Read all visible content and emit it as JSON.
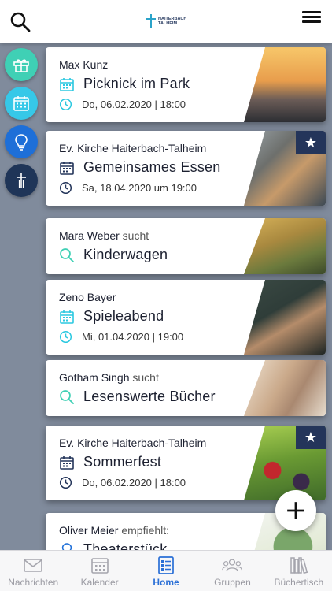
{
  "header": {
    "logo_line1": "HAITERBACH",
    "logo_line2": "TALHEIM"
  },
  "bubbles": [
    {
      "icon": "gift-icon",
      "color": "#3fd0b5"
    },
    {
      "icon": "calendar-icon",
      "color": "#36c8e8"
    },
    {
      "icon": "lightbulb-icon",
      "color": "#1e6fd8"
    },
    {
      "icon": "church-cross-icon",
      "color": "#1f3558"
    }
  ],
  "cards": [
    {
      "author": "Max Kunz",
      "author_suffix": "",
      "title": "Picknick im Park",
      "date": "Do, 06.02.2020 | 18:00",
      "kind": "event",
      "accent": "#2bc8e0",
      "featured": false
    },
    {
      "author": "Ev. Kirche Haiterbach-Talheim",
      "author_suffix": "",
      "title": "Gemeinsames Essen",
      "date": "Sa, 18.04.2020 um 19:00",
      "kind": "event",
      "accent": "#24355a",
      "featured": true
    },
    {
      "author": "Mara Weber",
      "author_suffix": "sucht",
      "title": "Kinderwagen",
      "date": "",
      "kind": "search",
      "accent": "#3fd0b5",
      "featured": false
    },
    {
      "author": "Zeno Bayer",
      "author_suffix": "",
      "title": "Spieleabend",
      "date": "Mi, 01.04.2020 | 19:00",
      "kind": "event",
      "accent": "#2bc8e0",
      "featured": false
    },
    {
      "author": "Gotham Singh",
      "author_suffix": "sucht",
      "title": "Lesenswerte Bücher",
      "date": "",
      "kind": "search",
      "accent": "#3fd0b5",
      "featured": false
    },
    {
      "author": "Ev. Kirche Haiterbach-Talheim",
      "author_suffix": "",
      "title": "Sommerfest",
      "date": "Do, 06.02.2020 | 18:00",
      "kind": "event",
      "accent": "#24355a",
      "featured": true
    },
    {
      "author": "Oliver Meier",
      "author_suffix": "empfiehlt:",
      "title": "Theaterstück",
      "date": "",
      "kind": "recommend",
      "accent": "#1e6fd8",
      "featured": false
    }
  ],
  "tabs": [
    {
      "label": "Nachrichten",
      "icon": "mail-icon",
      "active": false
    },
    {
      "label": "Kalender",
      "icon": "calendar-icon",
      "active": false
    },
    {
      "label": "Home",
      "icon": "home-list-icon",
      "active": true
    },
    {
      "label": "Gruppen",
      "icon": "group-icon",
      "active": false
    },
    {
      "label": "Büchertisch",
      "icon": "books-icon",
      "active": false
    }
  ]
}
